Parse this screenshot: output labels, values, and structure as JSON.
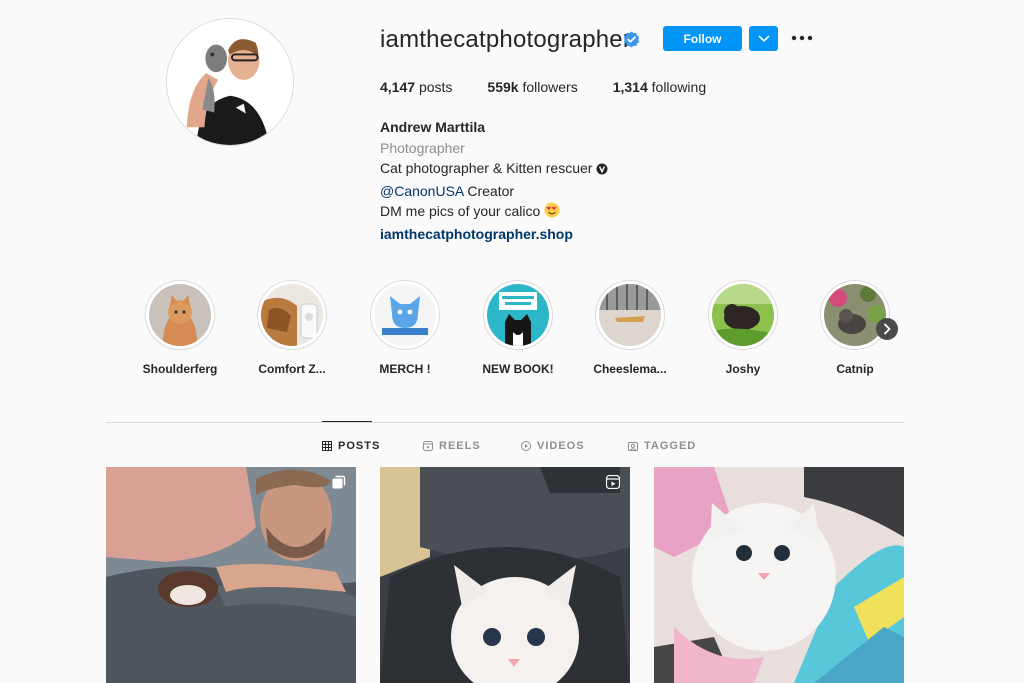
{
  "profile": {
    "username": "iamthecatphotographer",
    "verified": true,
    "follow_label": "Follow",
    "stats": {
      "posts_count": "4,147",
      "posts_label": "posts",
      "followers_count": "559k",
      "followers_label": "followers",
      "following_count": "1,314",
      "following_label": "following"
    },
    "bio": {
      "name": "Andrew Marttila",
      "category": "Photographer",
      "line1": "Cat photographer & Kitten rescuer",
      "mention": "@CanonUSA",
      "mention_suffix": " Creator",
      "line3": "DM me pics of your calico",
      "link": "iamthecatphotographer.shop"
    }
  },
  "highlights": [
    {
      "label": "Shoulderferg"
    },
    {
      "label": "Comfort Z..."
    },
    {
      "label": "MERCH !"
    },
    {
      "label": "NEW BOOK!"
    },
    {
      "label": "Cheeslema..."
    },
    {
      "label": "Joshy"
    },
    {
      "label": "Catnip"
    }
  ],
  "tabs": [
    {
      "label": "POSTS",
      "active": true
    },
    {
      "label": "REELS",
      "active": false
    },
    {
      "label": "VIDEOS",
      "active": false
    },
    {
      "label": "TAGGED",
      "active": false
    }
  ],
  "colors": {
    "accent": "#0095f6",
    "link": "#00376b",
    "verified": "#3897f0"
  }
}
